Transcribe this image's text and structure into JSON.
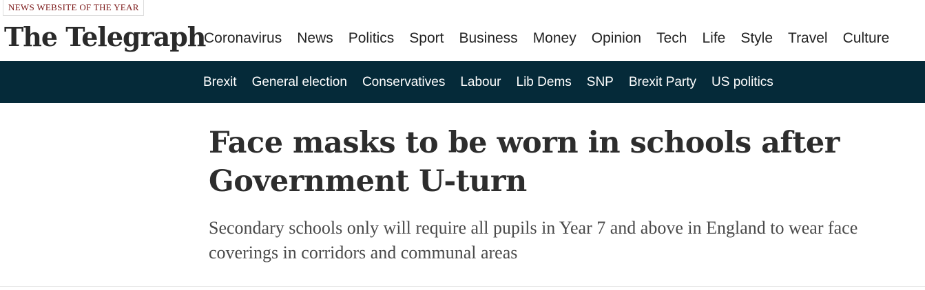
{
  "header": {
    "award_badge": "NEWS WEBSITE OF THE YEAR",
    "logo_text": "The Telegraph"
  },
  "primary_nav": {
    "items": [
      {
        "label": "Coronavirus"
      },
      {
        "label": "News"
      },
      {
        "label": "Politics",
        "active": true
      },
      {
        "label": "Sport"
      },
      {
        "label": "Business"
      },
      {
        "label": "Money"
      },
      {
        "label": "Opinion"
      },
      {
        "label": "Tech"
      },
      {
        "label": "Life"
      },
      {
        "label": "Style"
      },
      {
        "label": "Travel"
      },
      {
        "label": "Culture"
      }
    ],
    "active_indicator_color": "#0c8a8a"
  },
  "sub_nav": {
    "background_color": "#052a39",
    "items": [
      {
        "label": "Brexit"
      },
      {
        "label": "General election"
      },
      {
        "label": "Conservatives"
      },
      {
        "label": "Labour"
      },
      {
        "label": "Lib Dems"
      },
      {
        "label": "SNP"
      },
      {
        "label": "Brexit Party"
      },
      {
        "label": "US politics"
      }
    ]
  },
  "article": {
    "headline": "Face masks to be worn in schools after Government U-turn",
    "standfirst": "Secondary schools only will require all pupils in Year 7 and above in England to wear face coverings in corridors and communal areas"
  }
}
